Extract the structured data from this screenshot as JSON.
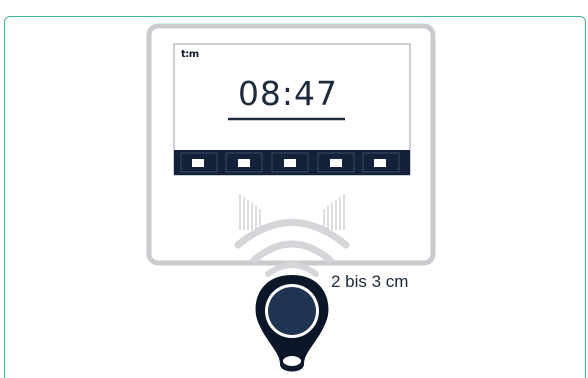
{
  "terminal": {
    "logo": "t:m",
    "time": "08:47",
    "function_keys": [
      "",
      "",
      "",
      "",
      ""
    ]
  },
  "transponder": {
    "distance_label": "2 bis 3 cm"
  },
  "colors": {
    "panel_border": "#3fb39b",
    "device_frame": "#c9cbce",
    "key_bar": "#13223a",
    "fob_body": "#0b1628",
    "fob_face": "#1f3352"
  }
}
